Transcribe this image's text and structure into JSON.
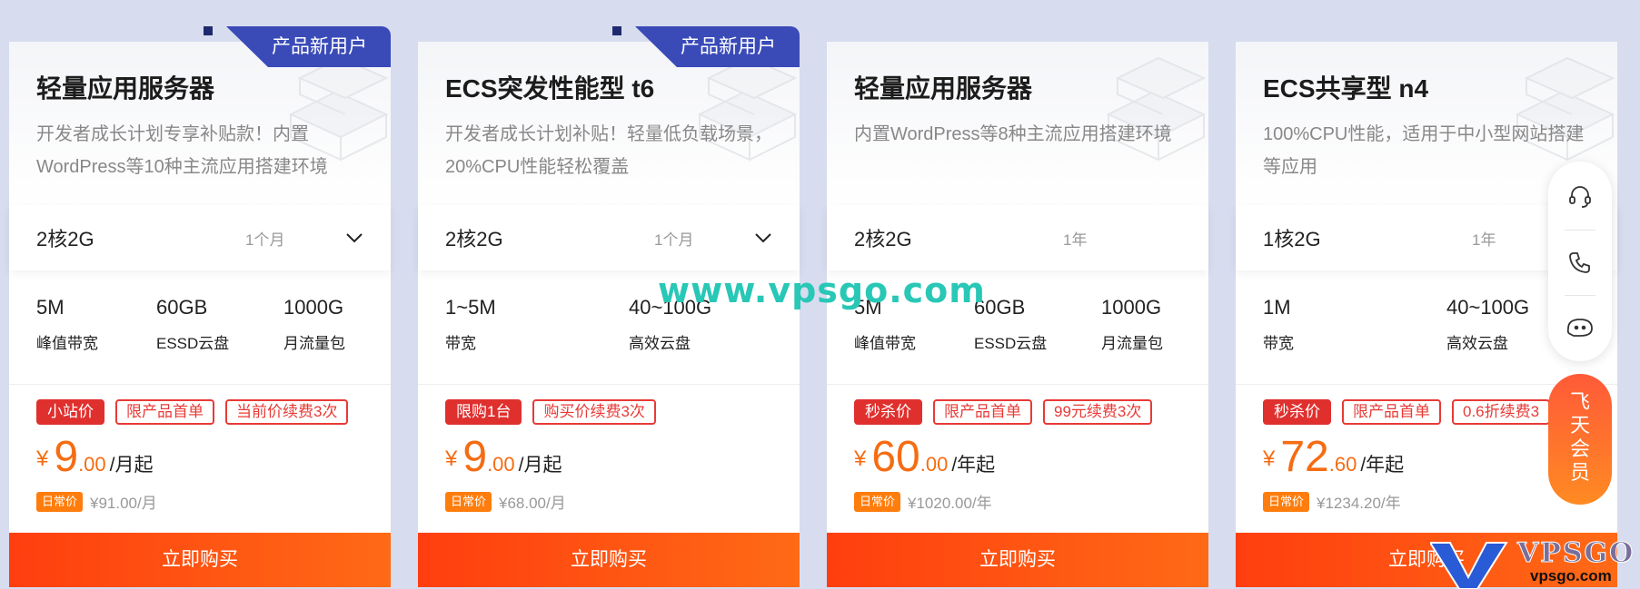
{
  "cards": [
    {
      "badge": "产品新用户",
      "title": "轻量应用服务器",
      "desc": "开发者成长计划专享补贴款！内置WordPress等10种主流应用搭建环境",
      "config": "2核2G",
      "period": "1个月",
      "has_dropdown": true,
      "features": [
        {
          "value": "5M",
          "label": "峰值带宽"
        },
        {
          "value": "60GB",
          "label": "ESSD云盘"
        },
        {
          "value": "1000G",
          "label": "月流量包"
        }
      ],
      "tags": [
        "小站价",
        "限产品首单",
        "当前价续费3次"
      ],
      "price_symbol": "¥",
      "price_int": "9",
      "price_dec": ".00",
      "price_unit": "/月起",
      "orig_tag": "日常价",
      "orig_price": "¥91.00/月",
      "buy_label": "立即购买"
    },
    {
      "badge": "产品新用户",
      "title": "ECS突发性能型 t6",
      "desc": "开发者成长计划补贴！轻量低负载场景，20%CPU性能轻松覆盖",
      "config": "2核2G",
      "period": "1个月",
      "has_dropdown": true,
      "features": [
        {
          "value": "1~5M",
          "label": "带宽"
        },
        {
          "value": "40~100G",
          "label": "高效云盘"
        }
      ],
      "tags": [
        "限购1台",
        "购买价续费3次"
      ],
      "price_symbol": "¥",
      "price_int": "9",
      "price_dec": ".00",
      "price_unit": "/月起",
      "orig_tag": "日常价",
      "orig_price": "¥68.00/月",
      "buy_label": "立即购买"
    },
    {
      "badge": "",
      "title": "轻量应用服务器",
      "desc": "内置WordPress等8种主流应用搭建环境",
      "config": "2核2G",
      "period": "1年",
      "has_dropdown": false,
      "features": [
        {
          "value": "5M",
          "label": "峰值带宽"
        },
        {
          "value": "60GB",
          "label": "ESSD云盘"
        },
        {
          "value": "1000G",
          "label": "月流量包"
        }
      ],
      "tags": [
        "秒杀价",
        "限产品首单",
        "99元续费3次"
      ],
      "price_symbol": "¥",
      "price_int": "60",
      "price_dec": ".00",
      "price_unit": "/年起",
      "orig_tag": "日常价",
      "orig_price": "¥1020.00/年",
      "buy_label": "立即购买"
    },
    {
      "badge": "",
      "title": "ECS共享型 n4",
      "desc": "100%CPU性能，适用于中小型网站搭建等应用",
      "config": "1核2G",
      "period": "1年",
      "has_dropdown": false,
      "features": [
        {
          "value": "1M",
          "label": "带宽"
        },
        {
          "value": "40~100G",
          "label": "高效云盘"
        }
      ],
      "tags": [
        "秒杀价",
        "限产品首单",
        "0.6折续费3"
      ],
      "price_symbol": "¥",
      "price_int": "72",
      "price_dec": ".60",
      "price_unit": "/年起",
      "orig_tag": "日常价",
      "orig_price": "¥1234.20/年",
      "buy_label": "立即购买"
    }
  ],
  "watermark": "www.vpsgo.com",
  "float_panel": {
    "icons": [
      "headset-icon",
      "phone-icon",
      "chat-bot-icon"
    ]
  },
  "vip_button": [
    "飞",
    "天",
    "会",
    "员"
  ],
  "logo": {
    "brand": "VPSGO",
    "url": "vpsgo.com"
  },
  "colors": {
    "background": "#d7dcef",
    "badge": "#3a4bb8",
    "tag_red": "#e83a36",
    "price_orange": "#f56c12",
    "buy_gradient_start": "#ff3e0f",
    "buy_gradient_end": "#ff6a16",
    "watermark": "#28c7b6"
  }
}
